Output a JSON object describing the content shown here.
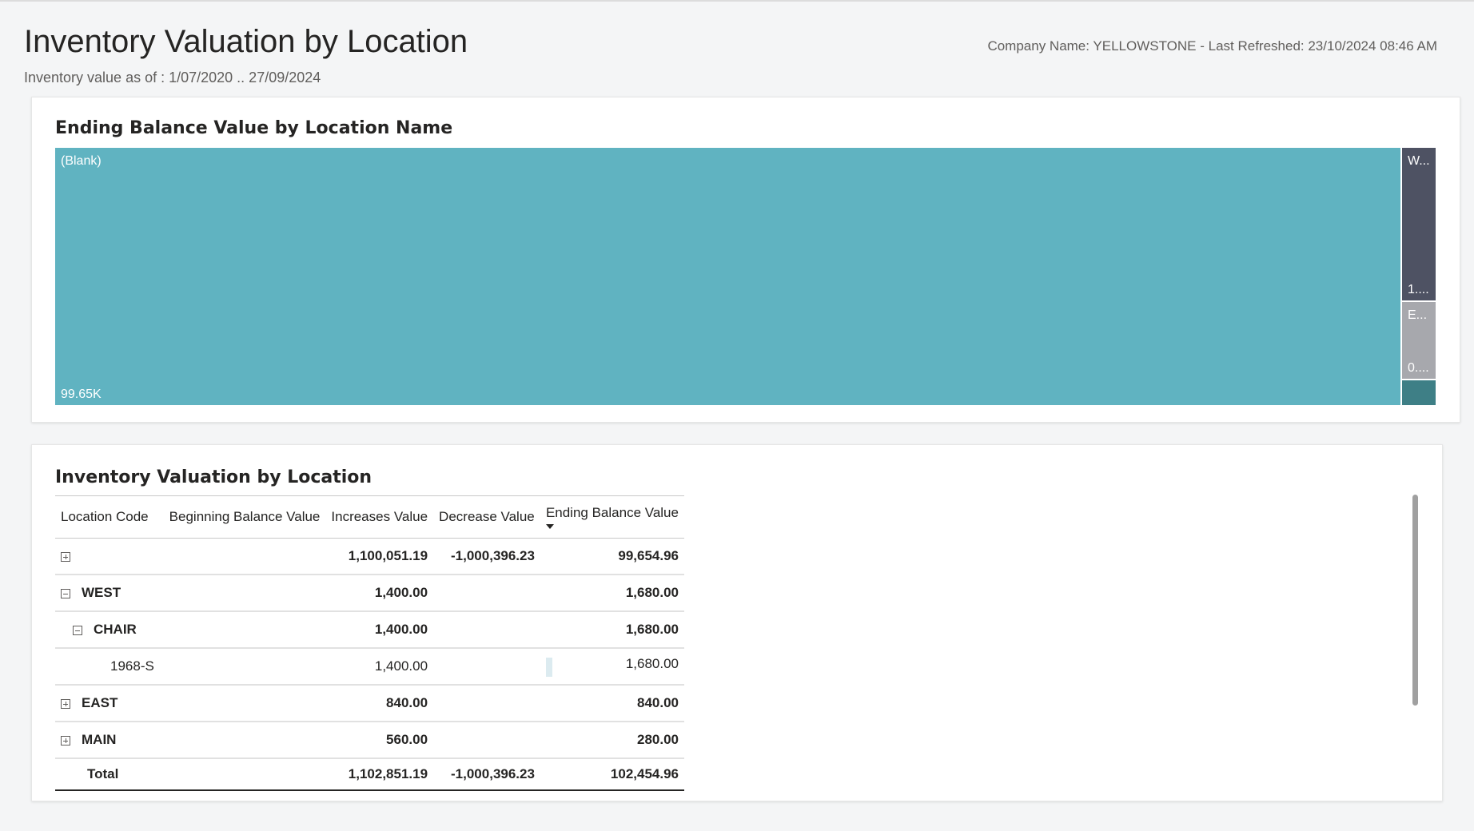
{
  "header": {
    "title": "Inventory Valuation by Location",
    "subtitle": "Inventory value as of : 1/07/2020 .. 27/09/2024",
    "company_info": "Company Name: YELLOWSTONE - Last Refreshed: 23/10/2024 08:46 AM"
  },
  "treemap": {
    "title": "Ending Balance Value by Location Name",
    "tiles": [
      {
        "label": "(Blank)",
        "value": "99.65K",
        "color": "#60b3c1"
      },
      {
        "label": "W...",
        "value": "1....",
        "color": "#4e5263"
      },
      {
        "label": "E...",
        "value": "0....",
        "color": "#a7a8ad"
      },
      {
        "label": "",
        "value": "",
        "color": "#3e7f86"
      }
    ]
  },
  "table": {
    "title": "Inventory Valuation by Location",
    "columns": [
      "Location Code",
      "Beginning Balance Value",
      "Increases Value",
      "Decrease Value",
      "Ending Balance Value"
    ],
    "rows": [
      {
        "code": "",
        "beginning": "",
        "increases": "1,100,051.19",
        "decrease": "-1,000,396.23",
        "ending": "99,654.96"
      },
      {
        "code": "WEST",
        "beginning": "",
        "increases": "1,400.00",
        "decrease": "",
        "ending": "1,680.00"
      },
      {
        "code": "CHAIR",
        "beginning": "",
        "increases": "1,400.00",
        "decrease": "",
        "ending": "1,680.00"
      },
      {
        "code": "1968-S",
        "beginning": "",
        "increases": "1,400.00",
        "decrease": "",
        "ending": "1,680.00"
      },
      {
        "code": "EAST",
        "beginning": "",
        "increases": "840.00",
        "decrease": "",
        "ending": "840.00"
      },
      {
        "code": "MAIN",
        "beginning": "",
        "increases": "560.00",
        "decrease": "",
        "ending": "280.00"
      }
    ],
    "total": {
      "label": "Total",
      "beginning": "",
      "increases": "1,102,851.19",
      "decrease": "-1,000,396.23",
      "ending": "102,454.96"
    }
  }
}
